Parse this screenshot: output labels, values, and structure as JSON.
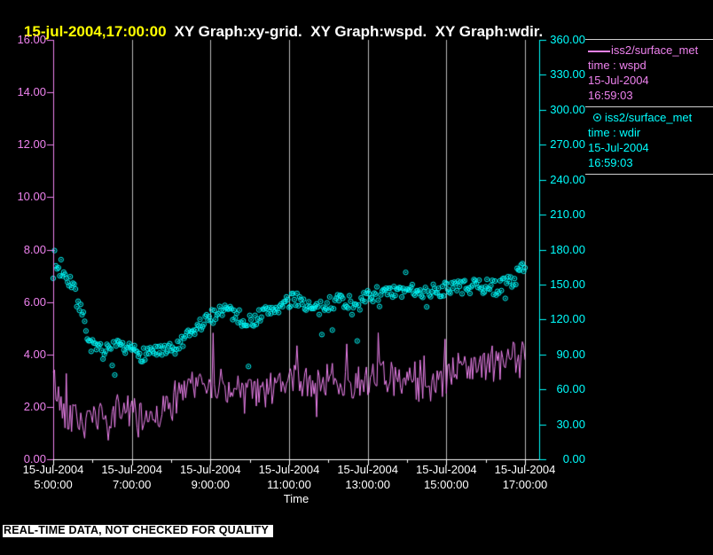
{
  "window": {
    "title_timestamp": "15-jul-2004,17:00:00",
    "title_graphs": "XY Graph:xy-grid.  XY Graph:wspd.  XY Graph:wdir."
  },
  "banner": {
    "text": "REAL-TIME DATA, NOT CHECKED FOR QUALITY"
  },
  "legend": {
    "entries": [
      {
        "glyph": "line",
        "source": "iss2/surface_met",
        "variable": "time : wspd",
        "date": "15-Jul-2004",
        "time": "16:59:03",
        "color": "#ee82ee"
      },
      {
        "glyph": "circle",
        "source": "iss2/surface_met",
        "variable": "time : wdir",
        "date": "15-Jul-2004",
        "time": "16:59:03",
        "color": "#00ffff"
      }
    ]
  },
  "colors": {
    "background": "#000000",
    "wspd": "#ee82ee",
    "wdir": "#00ffff",
    "grid": "#b8b8b8",
    "x_axis": "#ffffff",
    "title_timestamp": "#ffff00",
    "title_text": "#ffffff"
  },
  "chart_data": {
    "type": "line+scatter",
    "x_axis": {
      "label": "Time",
      "start_hour": 5,
      "end_hour": 17,
      "major_tick_hours": [
        5,
        7,
        9,
        11,
        13,
        15,
        17
      ],
      "minor_tick_hours": [
        6,
        8,
        10,
        12,
        14,
        16
      ],
      "tick_labels": [
        {
          "date": "15-Jul-2004",
          "time": "5:00:00"
        },
        {
          "date": "15-Jul-2004",
          "time": "7:00:00"
        },
        {
          "date": "15-Jul-2004",
          "time": "9:00:00"
        },
        {
          "date": "15-Jul-2004",
          "time": "11:00:00"
        },
        {
          "date": "15-Jul-2004",
          "time": "13:00:00"
        },
        {
          "date": "15-Jul-2004",
          "time": "15:00:00"
        },
        {
          "date": "15-Jul-2004",
          "time": "17:00:00"
        }
      ]
    },
    "left_axis": {
      "variable": "wspd",
      "min": 0,
      "max": 16,
      "tick_step": 2,
      "color": "#ee82ee",
      "tick_labels": [
        "16.00",
        "14.00",
        "12.00",
        "10.00",
        "8.00",
        "6.00",
        "4.00",
        "2.00",
        "0.00"
      ]
    },
    "right_axis": {
      "variable": "wdir",
      "min": 0,
      "max": 360,
      "tick_step": 30,
      "color": "#00ffff",
      "tick_labels": [
        "360.00",
        "330.00",
        "300.00",
        "270.00",
        "240.00",
        "210.00",
        "180.00",
        "150.00",
        "120.00",
        "90.00",
        "60.00",
        "30.00",
        "0.00"
      ]
    },
    "grid": {
      "vertical_at_hours": [
        7,
        9,
        11,
        13,
        15,
        17
      ],
      "color": "#b8b8b8"
    },
    "series": [
      {
        "name": "wspd",
        "plot": "line",
        "axis": "left",
        "color": "#ee82ee",
        "sample_minutes": 2,
        "noise_amplitude": 0.65,
        "spike_amplitude": 0.9,
        "seed": 42,
        "keyframes_min_value": [
          [
            0,
            3.2
          ],
          [
            4,
            2.7
          ],
          [
            8,
            2.3
          ],
          [
            15,
            1.9
          ],
          [
            25,
            1.7
          ],
          [
            35,
            1.6
          ],
          [
            45,
            1.4
          ],
          [
            55,
            1.25
          ],
          [
            65,
            1.6
          ],
          [
            75,
            1.45
          ],
          [
            85,
            1.3
          ],
          [
            95,
            1.8
          ],
          [
            105,
            2.0
          ],
          [
            115,
            1.95
          ],
          [
            120,
            1.7
          ],
          [
            130,
            1.45
          ],
          [
            140,
            1.6
          ],
          [
            155,
            1.75
          ],
          [
            170,
            1.9
          ],
          [
            185,
            2.1
          ],
          [
            200,
            2.5
          ],
          [
            215,
            2.8
          ],
          [
            230,
            2.95
          ],
          [
            240,
            3.0
          ],
          [
            255,
            2.85
          ],
          [
            270,
            2.7
          ],
          [
            285,
            2.6
          ],
          [
            300,
            2.55
          ],
          [
            315,
            2.45
          ],
          [
            330,
            2.6
          ],
          [
            345,
            2.75
          ],
          [
            360,
            2.9
          ],
          [
            375,
            3.0
          ],
          [
            390,
            2.85
          ],
          [
            405,
            2.9
          ],
          [
            420,
            3.0
          ],
          [
            435,
            3.1
          ],
          [
            450,
            2.95
          ],
          [
            465,
            3.0
          ],
          [
            480,
            3.1
          ],
          [
            495,
            3.25
          ],
          [
            510,
            3.15
          ],
          [
            525,
            3.0
          ],
          [
            540,
            2.9
          ],
          [
            555,
            2.8
          ],
          [
            570,
            2.65
          ],
          [
            585,
            2.75
          ],
          [
            600,
            2.9
          ],
          [
            610,
            3.3
          ],
          [
            620,
            3.6
          ],
          [
            630,
            3.75
          ],
          [
            645,
            3.6
          ],
          [
            660,
            3.45
          ],
          [
            675,
            3.5
          ],
          [
            690,
            3.65
          ],
          [
            700,
            3.8
          ],
          [
            710,
            3.95
          ],
          [
            720,
            4.3
          ]
        ]
      },
      {
        "name": "wdir",
        "plot": "scatter",
        "marker": "circle-dot",
        "axis": "right",
        "color": "#00ffff",
        "sample_minutes": 2,
        "noise_amplitude": 6.5,
        "seed": 7,
        "keyframes_min_value": [
          [
            0,
            168
          ],
          [
            8,
            163
          ],
          [
            16,
            166
          ],
          [
            24,
            158
          ],
          [
            32,
            148
          ],
          [
            40,
            134
          ],
          [
            48,
            116
          ],
          [
            56,
            100
          ],
          [
            64,
            94
          ],
          [
            80,
            92
          ],
          [
            96,
            96
          ],
          [
            112,
            92
          ],
          [
            120,
            94
          ],
          [
            136,
            90
          ],
          [
            152,
            94
          ],
          [
            168,
            91
          ],
          [
            184,
            94
          ],
          [
            200,
            101
          ],
          [
            212,
            108
          ],
          [
            224,
            115
          ],
          [
            240,
            121
          ],
          [
            252,
            128
          ],
          [
            264,
            130
          ],
          [
            276,
            125
          ],
          [
            288,
            120
          ],
          [
            300,
            118
          ],
          [
            315,
            123
          ],
          [
            330,
            128
          ],
          [
            345,
            131
          ],
          [
            360,
            134
          ],
          [
            372,
            139
          ],
          [
            384,
            134
          ],
          [
            396,
            128
          ],
          [
            408,
            129
          ],
          [
            420,
            133
          ],
          [
            435,
            138
          ],
          [
            450,
            135
          ],
          [
            465,
            133
          ],
          [
            480,
            139
          ],
          [
            495,
            143
          ],
          [
            510,
            141
          ],
          [
            525,
            143
          ],
          [
            540,
            144
          ],
          [
            555,
            147
          ],
          [
            570,
            143
          ],
          [
            585,
            145
          ],
          [
            600,
            146
          ],
          [
            615,
            149
          ],
          [
            630,
            147
          ],
          [
            645,
            148
          ],
          [
            660,
            149
          ],
          [
            675,
            147
          ],
          [
            690,
            151
          ],
          [
            702,
            154
          ],
          [
            712,
            160
          ],
          [
            720,
            169
          ]
        ]
      }
    ]
  }
}
